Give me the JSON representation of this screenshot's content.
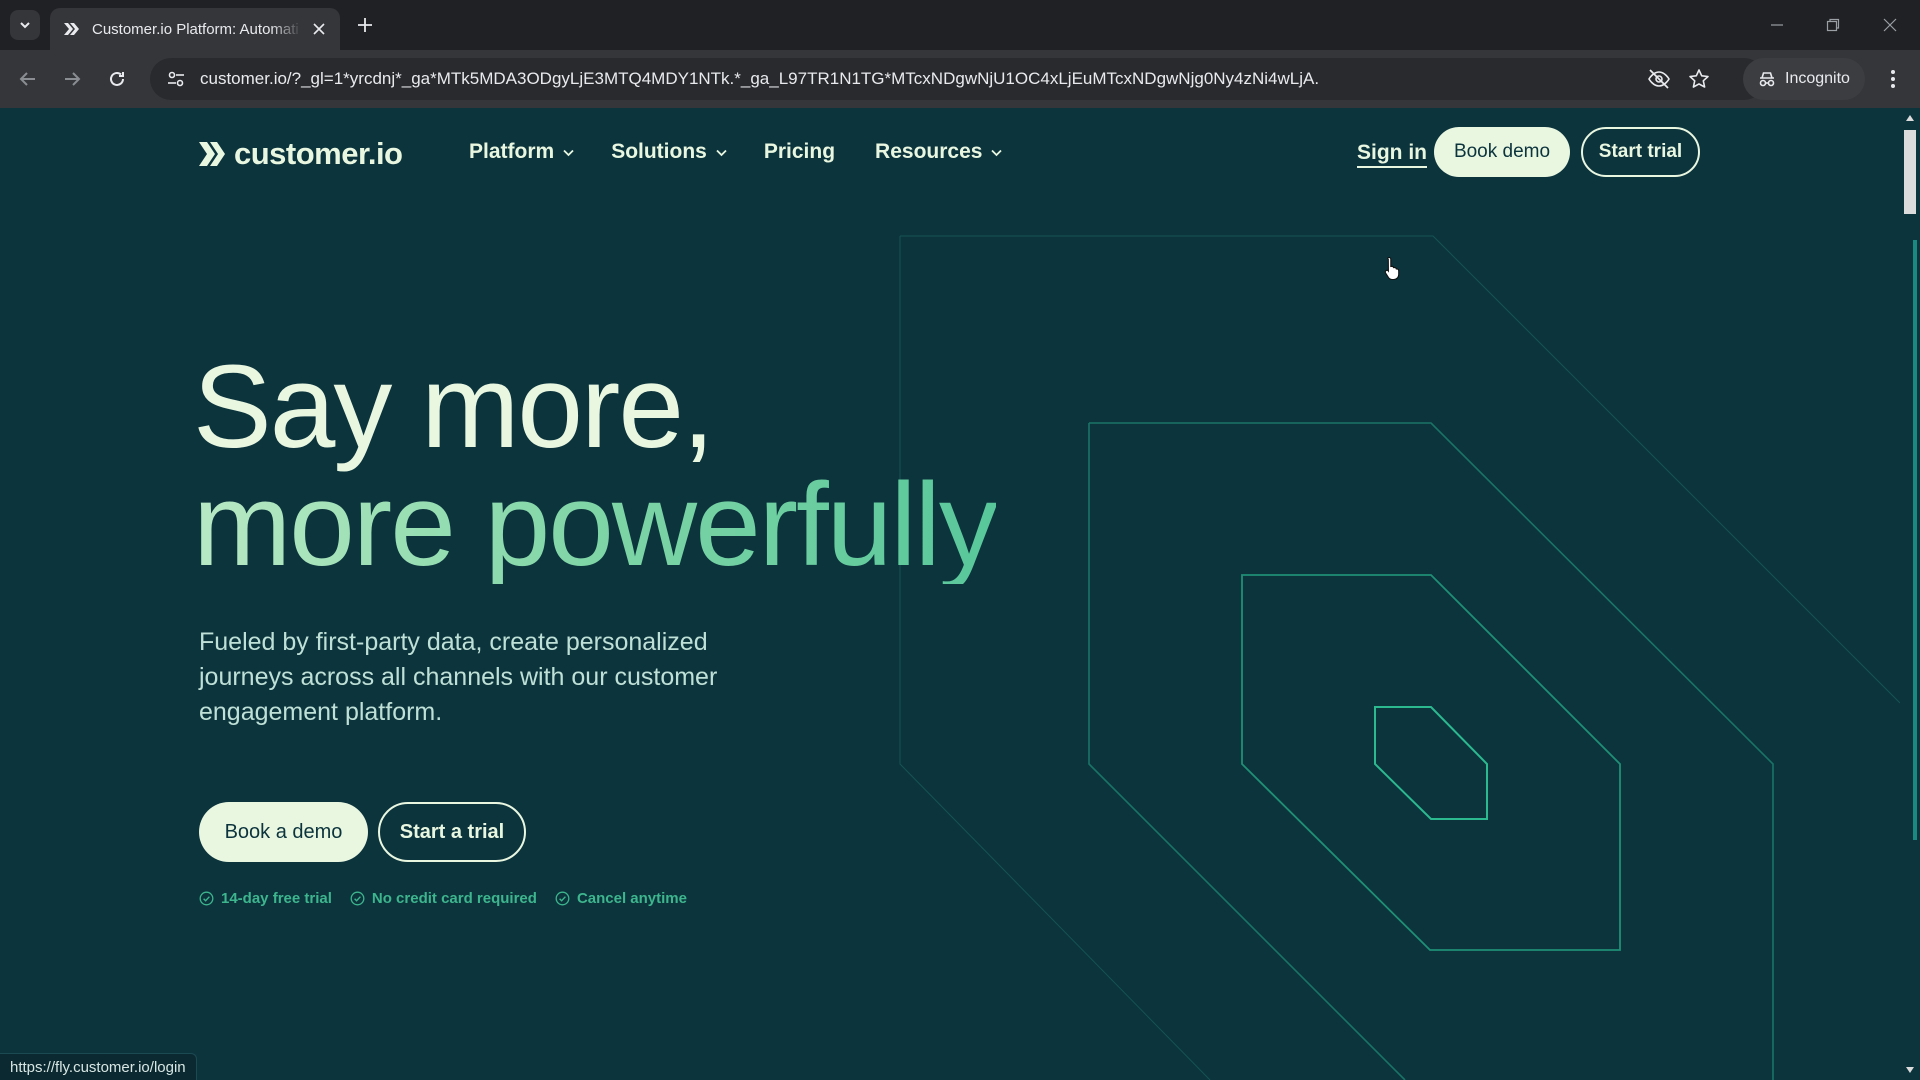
{
  "browser": {
    "tab_title": "Customer.io Platform: Automati",
    "url": "customer.io/?_gl=1*yrcdnj*_ga*MTk5MDA3ODgyLjE3MTQ4MDY1NTk.*_ga_L97TR1N1TG*MTcxNDgwNjU1OC4xLjEuMTcxNDgwNjg0Ny4zNi4wLjA.",
    "incognito_label": "Incognito",
    "status_url": "https://fly.customer.io/login"
  },
  "header": {
    "logo_text": "customer.io",
    "nav": [
      {
        "label": "Platform",
        "has_dropdown": true
      },
      {
        "label": "Solutions",
        "has_dropdown": true
      },
      {
        "label": "Pricing",
        "has_dropdown": false
      },
      {
        "label": "Resources",
        "has_dropdown": true
      }
    ],
    "sign_in": "Sign in",
    "book_demo": "Book demo",
    "start_trial": "Start trial"
  },
  "hero": {
    "title_line1": "Say more,",
    "title_line2": "more powerfully",
    "subtitle": "Fueled by first-party data, create personalized journeys across all channels with our customer engagement platform.",
    "cta_primary": "Book a demo",
    "cta_secondary": "Start a trial",
    "perks": [
      "14-day free trial",
      "No credit card required",
      "Cancel anytime"
    ]
  },
  "colors": {
    "page_bg": "#0c343d",
    "cream": "#e9f7e1",
    "accent_green": "#3db58d",
    "outline_green": "#1f8a74"
  },
  "icons": {
    "tab_menu": "chevron-down-icon",
    "tab_close": "close-icon",
    "new_tab": "plus-icon",
    "back": "arrow-left-icon",
    "forward": "arrow-right-icon",
    "reload": "reload-icon",
    "site_info": "tune-icon",
    "eye_off": "eye-off-icon",
    "bookmark": "star-icon",
    "incognito": "incognito-icon",
    "menu": "kebab-menu-icon",
    "perk_check": "check-circle-icon"
  }
}
